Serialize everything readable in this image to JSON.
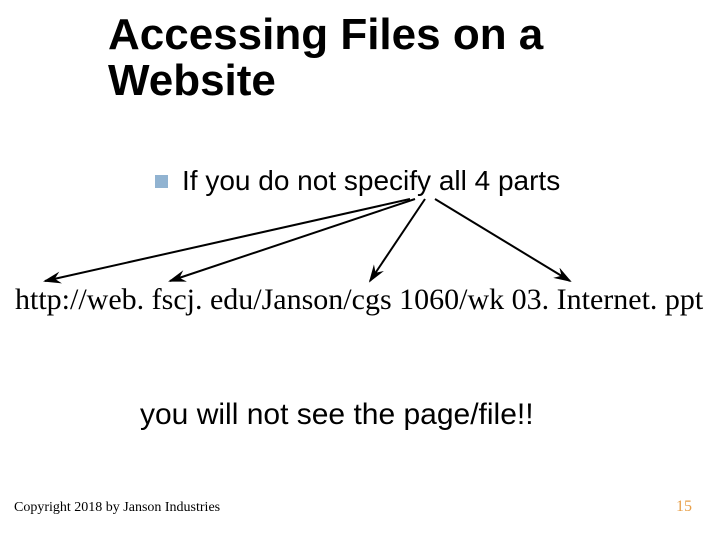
{
  "title": "Accessing Files on a Website",
  "bullet": "If you do not specify all 4 parts",
  "url": {
    "part1": "http:",
    "part2": "//web. fscj. edu",
    "part3_a": "/Janson",
    "part3_b": "/cgs 1060",
    "part4": "/wk 03. Internet. ppt"
  },
  "bottom": "you will not see the page/file!!",
  "copyright": "Copyright 2018 by Janson Industries",
  "slide_number": "15"
}
